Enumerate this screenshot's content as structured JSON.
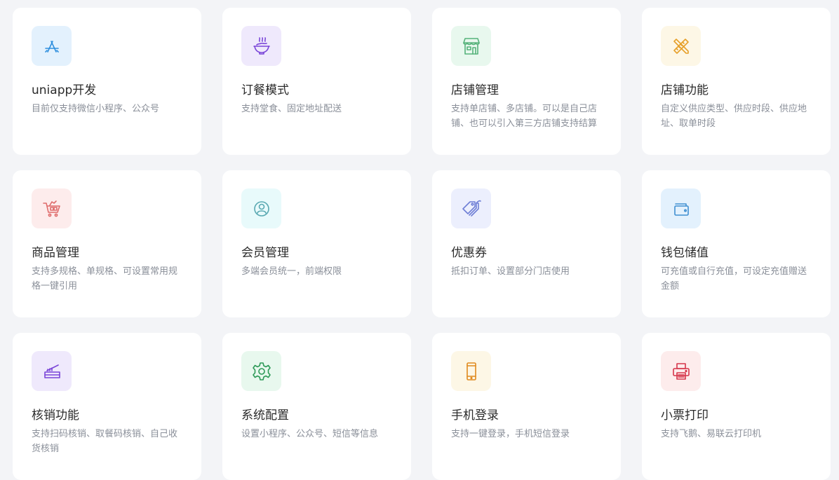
{
  "features": [
    {
      "title": "uniapp开发",
      "desc": "目前仅支持微信小程序、公众号",
      "icon": "app-store-icon",
      "bg": "#e3f1fd",
      "color": "#2f8fde"
    },
    {
      "title": "订餐模式",
      "desc": "支持堂食、固定地址配送",
      "icon": "noodle-bowl-icon",
      "bg": "#efe9fc",
      "color": "#7a45d8"
    },
    {
      "title": "店铺管理",
      "desc": "支持单店铺、多店铺。可以是自己店铺、也可以引入第三方店铺支持结算",
      "icon": "storefront-icon",
      "bg": "#e8f8ee",
      "color": "#55b27a"
    },
    {
      "title": "店铺功能",
      "desc": "自定义供应类型、供应时段、供应地址、取单时段",
      "icon": "pencil-ruler-icon",
      "bg": "#fdf7e6",
      "color": "#e6a12b"
    },
    {
      "title": "商品管理",
      "desc": "支持多规格、单规格、可设置常用规格一键引用",
      "icon": "shopping-cart-icon",
      "bg": "#fdecec",
      "color": "#df6b6b"
    },
    {
      "title": "会员管理",
      "desc": "多端会员统一，前端权限",
      "icon": "member-icon",
      "bg": "#e8fafb",
      "color": "#5aa9b2"
    },
    {
      "title": "优惠券",
      "desc": "抵扣订单、设置部分门店使用",
      "icon": "coupon-tag-icon",
      "bg": "#eceffd",
      "color": "#6f7fd6"
    },
    {
      "title": "钱包储值",
      "desc": "可充值或自行充值，可设定充值赠送金额",
      "icon": "wallet-icon",
      "bg": "#e3f1fd",
      "color": "#3f8fd1"
    },
    {
      "title": "核销功能",
      "desc": "支持扫码核销、取餐码核销、自己收货核销",
      "icon": "scanner-icon",
      "bg": "#efe9fc",
      "color": "#7a45d8"
    },
    {
      "title": "系统配置",
      "desc": "设置小程序、公众号、短信等信息",
      "icon": "gear-icon",
      "bg": "#e8f8ee",
      "color": "#2e9a58"
    },
    {
      "title": "手机登录",
      "desc": "支持一键登录，手机短信登录",
      "icon": "mobile-phone-icon",
      "bg": "#fdf7e6",
      "color": "#e08a1e"
    },
    {
      "title": "小票打印",
      "desc": "支持飞鹅、易联云打印机",
      "icon": "printer-icon",
      "bg": "#fdecec",
      "color": "#d6364b"
    }
  ]
}
